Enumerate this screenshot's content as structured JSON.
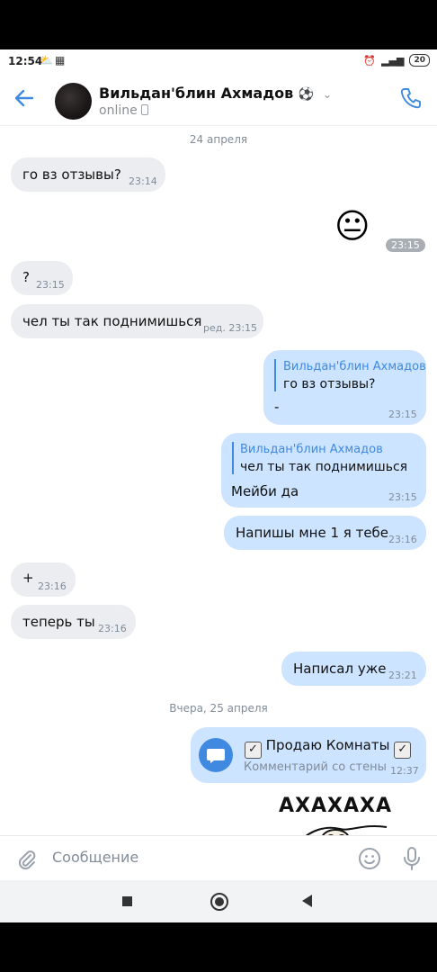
{
  "status_bar": {
    "time": "12:54",
    "battery": "20"
  },
  "header": {
    "name": "Вильдан'блин Ахмадов",
    "name_emoji": "⚽",
    "status": "online"
  },
  "chat": {
    "date_1": "24 апреля",
    "date_2": "Вчера, 25 апреля",
    "messages": [
      {
        "text": "го вз отзывы?",
        "time": "23:14"
      },
      {
        "text": "😐",
        "time": "23:15"
      },
      {
        "text": "?",
        "time": "23:15"
      },
      {
        "text": "чел ты так поднимишься",
        "time": "ред. 23:15"
      },
      {
        "reply_author": "Вильдан'блин Ахмадов",
        "reply_text": "го вз отзывы?",
        "text": "-",
        "time": "23:15"
      },
      {
        "reply_author": "Вильдан'блин Ахмадов",
        "reply_text": "чел ты так поднимишься",
        "text": "Мейби да",
        "time": "23:15"
      },
      {
        "text": "Напишы мне 1 я тебе",
        "time": "23:16"
      },
      {
        "text": "+",
        "time": "23:16"
      },
      {
        "text": "теперь ты",
        "time": "23:16"
      },
      {
        "text": "Написал уже",
        "time": "23:21"
      },
      {
        "title": "Продаю Комнаты",
        "subtitle": "Комментарий со стены",
        "time": "12:37"
      },
      {
        "text": "АХАХАХА"
      }
    ]
  },
  "composer": {
    "placeholder": "Сообщение"
  },
  "colors": {
    "accent": "#3f8ae0",
    "incoming": "#ebedf0",
    "outgoing": "#cce4ff"
  }
}
